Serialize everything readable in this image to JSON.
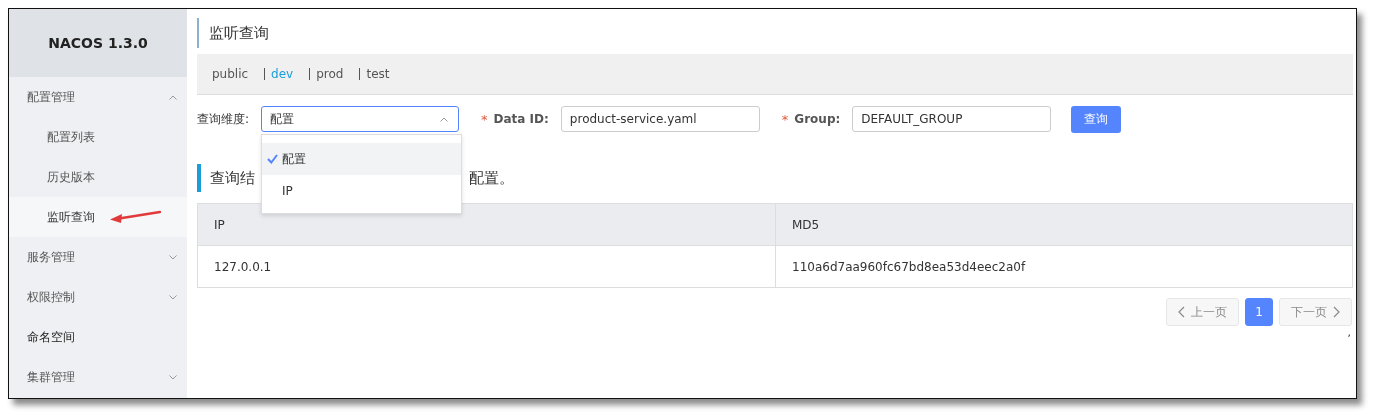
{
  "sidebar": {
    "title": "NACOS 1.3.0",
    "items": [
      {
        "label": "配置管理",
        "expanded": true,
        "selected": false,
        "children": [
          {
            "label": "配置列表",
            "selected": false
          },
          {
            "label": "历史版本",
            "selected": false
          },
          {
            "label": "监听查询",
            "selected": true
          }
        ]
      },
      {
        "label": "服务管理",
        "expanded": false,
        "selected": false
      },
      {
        "label": "权限控制",
        "expanded": false,
        "selected": false
      },
      {
        "label": "命名空间",
        "selected": false
      },
      {
        "label": "集群管理",
        "expanded": false,
        "selected": false
      }
    ]
  },
  "page_title": "监听查询",
  "namespaces": [
    {
      "label": "public",
      "selected": false
    },
    {
      "label": "dev",
      "selected": true
    },
    {
      "label": "prod",
      "selected": false
    },
    {
      "label": "test",
      "selected": false
    }
  ],
  "form": {
    "dimension_label": "查询维度:",
    "dimension_value": "配置",
    "dropdown_open": true,
    "options": [
      {
        "label": "配置",
        "selected": true
      },
      {
        "label": "IP",
        "selected": false
      }
    ],
    "fields": [
      {
        "label": "Data ID:",
        "required_mark": "*",
        "value": "product-service.yaml"
      },
      {
        "label": "Group:",
        "required_mark": "*",
        "value": "DEFAULT_GROUP"
      }
    ],
    "submit": "查询"
  },
  "result_title": [
    "查询结",
    "配置。"
  ],
  "table": {
    "columns": [
      "IP",
      "MD5"
    ],
    "rows": [
      [
        "127.0.0.1",
        "110a6d7aa960fc67bd8ea53d4eec2a0f"
      ]
    ]
  },
  "pagination": {
    "prev": {
      "label": "上一页",
      "disabled": true
    },
    "pages": [
      {
        "label": "1",
        "selected": true
      }
    ],
    "next": {
      "label": "下一页",
      "disabled": true
    }
  },
  "footer_mark": ","
}
